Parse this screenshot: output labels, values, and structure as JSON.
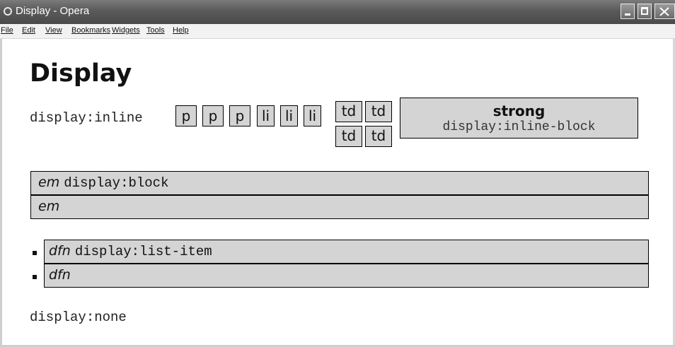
{
  "window": {
    "title": "Display - Opera"
  },
  "menu": {
    "items": [
      "File",
      "Edit",
      "View",
      "Bookmarks",
      "Widgets",
      "Tools",
      "Help"
    ]
  },
  "page": {
    "heading": "Display",
    "inline_label": "display:inline",
    "p_boxes": [
      "p",
      "p",
      "p"
    ],
    "li_boxes": [
      "li",
      "li",
      "li"
    ],
    "td_boxes": [
      "td",
      "td",
      "td",
      "td"
    ],
    "strong_label": "strong",
    "inline_block_label": "display:inline-block",
    "em_tag": "em",
    "block_label": "display:block",
    "em_tag_2": "em",
    "dfn_tag": "dfn",
    "list_item_label": "display:list-item",
    "dfn_tag_2": "dfn",
    "none_label": "display:none"
  }
}
